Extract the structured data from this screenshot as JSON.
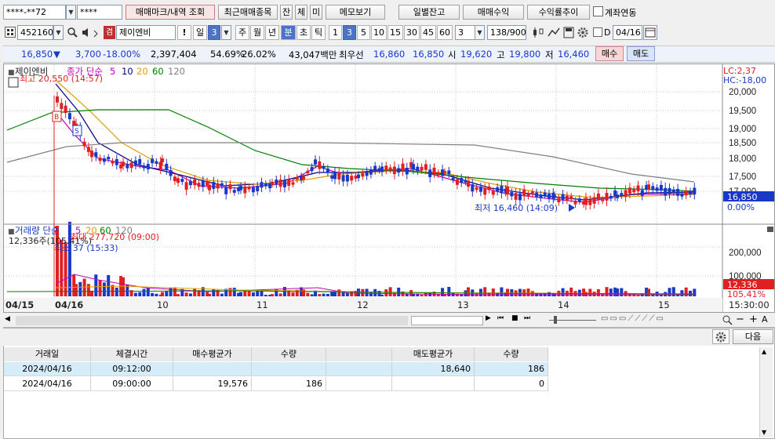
{
  "row1": {
    "account": "****-**72",
    "password": "****",
    "b_mark": "매매마크/내역 조회",
    "b_recent": "최근매매종목",
    "b_jan": "잔",
    "b_che": "체",
    "b_mi": "미",
    "b_memo": "메모보기",
    "b_daily": "일별잔고",
    "b_profit": "매매수익",
    "b_rate": "수익률추이",
    "chk_link": "계좌연동"
  },
  "row2": {
    "code": "452160",
    "name_badge": "겸",
    "name": "제이엔비",
    "periods": [
      "일",
      "3",
      "주",
      "월",
      "년",
      "분",
      "초",
      "틱"
    ],
    "mins": [
      "1",
      "3",
      "5",
      "10",
      "15",
      "30",
      "45",
      "60"
    ],
    "tick_sel": "3",
    "count": "138",
    "count_total": "/900",
    "date": "04/16",
    "chk_d": "D"
  },
  "quote": {
    "price": "16,850",
    "change_arrow": "▼",
    "change": "3,700",
    "change_rate": "-18.00%",
    "volume": "2,397,404",
    "vol_ratio": "54.69%",
    "turnover": "26.02%",
    "amount": "43,047백만",
    "best_label": "최우선",
    "best_ask": "16,860",
    "best_bid": "16,850",
    "open_label": "시",
    "open": "19,620",
    "high_label": "고",
    "high": "19,800",
    "low_label": "저",
    "low": "16,460",
    "buy_btn": "매수",
    "sell_btn": "매도"
  },
  "price_panel": {
    "name": "제이엔비",
    "legend_title": "종가 단순",
    "ma": [
      "5",
      "10",
      "20",
      "60",
      "120"
    ],
    "ma_colors": [
      "#c000c0",
      "#000080",
      "#e0a000",
      "#008000",
      "#808080"
    ],
    "max_label": "최고 20,550 (14:57)",
    "min_label": "최저 16,460 (14:09)",
    "lc": "LC:2,37",
    "hc": "HC:-18,00",
    "yaxis": [
      "20,000",
      "19,500",
      "19,000",
      "18,500",
      "18,000",
      "17,500",
      "17,000"
    ],
    "last_price_tag": "16,850",
    "pct_tag": "0.00%",
    "marks": [
      "B",
      "S"
    ]
  },
  "volume_panel": {
    "label": "거래량 단순",
    "ma": [
      "5",
      "20",
      "60",
      "120"
    ],
    "ma_colors": [
      "#c000c0",
      "#e0a000",
      "#008000",
      "#808080"
    ],
    "last": "12,336주(105.41%)",
    "max_label": "최대 277,720 (09:00)",
    "min_label": "최소 37 (15:33)",
    "yaxis": [
      "200,000",
      "100,000"
    ],
    "last_tag": "12,336",
    "pct_tag": "105.41%"
  },
  "xaxis": [
    "04/15",
    "04/16",
    "10",
    "11",
    "12",
    "13",
    "14",
    "15",
    "15:30:00"
  ],
  "table": {
    "next_btn": "다음",
    "headers": [
      "거래일",
      "체결시간",
      "매수평균가",
      "수량",
      "",
      "매도평균가",
      "수량"
    ],
    "rows": [
      [
        "2024/04/16",
        "09:12:00",
        "",
        "",
        "",
        "18,640",
        "186"
      ],
      [
        "2024/04/16",
        "09:00:00",
        "19,576",
        "186",
        "",
        "",
        "0"
      ]
    ]
  },
  "colors": {
    "up": "#e02020",
    "down": "#1838c8",
    "accent": "#4d74c4"
  }
}
